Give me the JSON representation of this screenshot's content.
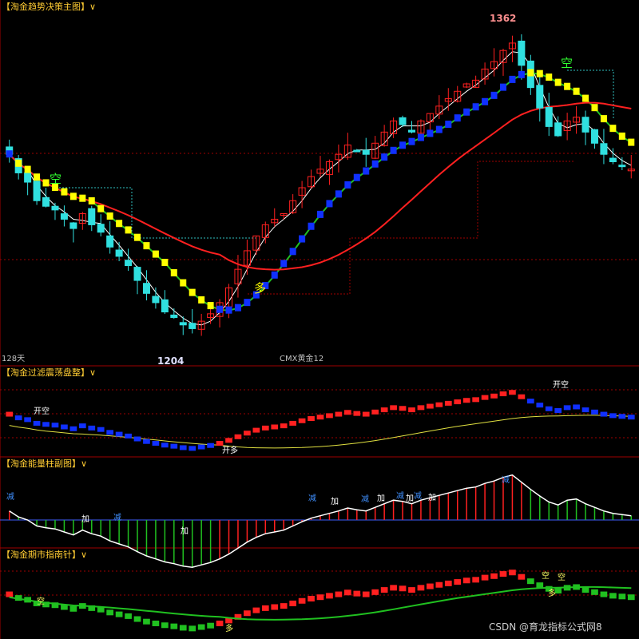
{
  "panels": {
    "main": {
      "title": "【淘金趋势决策主图】∨",
      "period": "128天",
      "symbol": "CMX黄金12",
      "high_label": "1362",
      "low_label": "1204",
      "signal_kong": "空",
      "signal_duo": "多"
    },
    "osc": {
      "title": "【淘金过滤震荡盘整】∨",
      "open_kong": "开空",
      "open_duo": "开多"
    },
    "energy": {
      "title": "【淘金能量柱副图】∨",
      "jian": "减",
      "jia": "加"
    },
    "guide": {
      "title": "【淘金期市指南针】∨",
      "kong": "空",
      "duo": "多"
    }
  },
  "watermark": "CSDN @育龙指标公式网8",
  "colors": {
    "up": "#ff2020",
    "down": "#30e0e0",
    "bull_bar": "#1030ff",
    "bear_bar": "#ffff00",
    "ma_short": "#ffffff",
    "ma_mid": "#20c020",
    "ma_long": "#ff2020",
    "zone": "#30c0c0",
    "grid": "#a00000"
  },
  "chart_data": {
    "type": "candlestick",
    "price_high": 1362,
    "price_low": 1204,
    "closes": [
      1300,
      1290,
      1285,
      1275,
      1272,
      1270,
      1265,
      1260,
      1268,
      1262,
      1258,
      1250,
      1245,
      1240,
      1232,
      1225,
      1220,
      1215,
      1212,
      1208,
      1206,
      1210,
      1214,
      1220,
      1228,
      1238,
      1248,
      1256,
      1262,
      1265,
      1268,
      1275,
      1282,
      1288,
      1292,
      1296,
      1300,
      1305,
      1302,
      1300,
      1306,
      1312,
      1318,
      1316,
      1312,
      1318,
      1322,
      1326,
      1330,
      1334,
      1338,
      1340,
      1346,
      1350,
      1356,
      1360,
      1348,
      1336,
      1325,
      1315,
      1310,
      1318,
      1320,
      1312,
      1306,
      1300,
      1296,
      1294,
      1292
    ]
  }
}
